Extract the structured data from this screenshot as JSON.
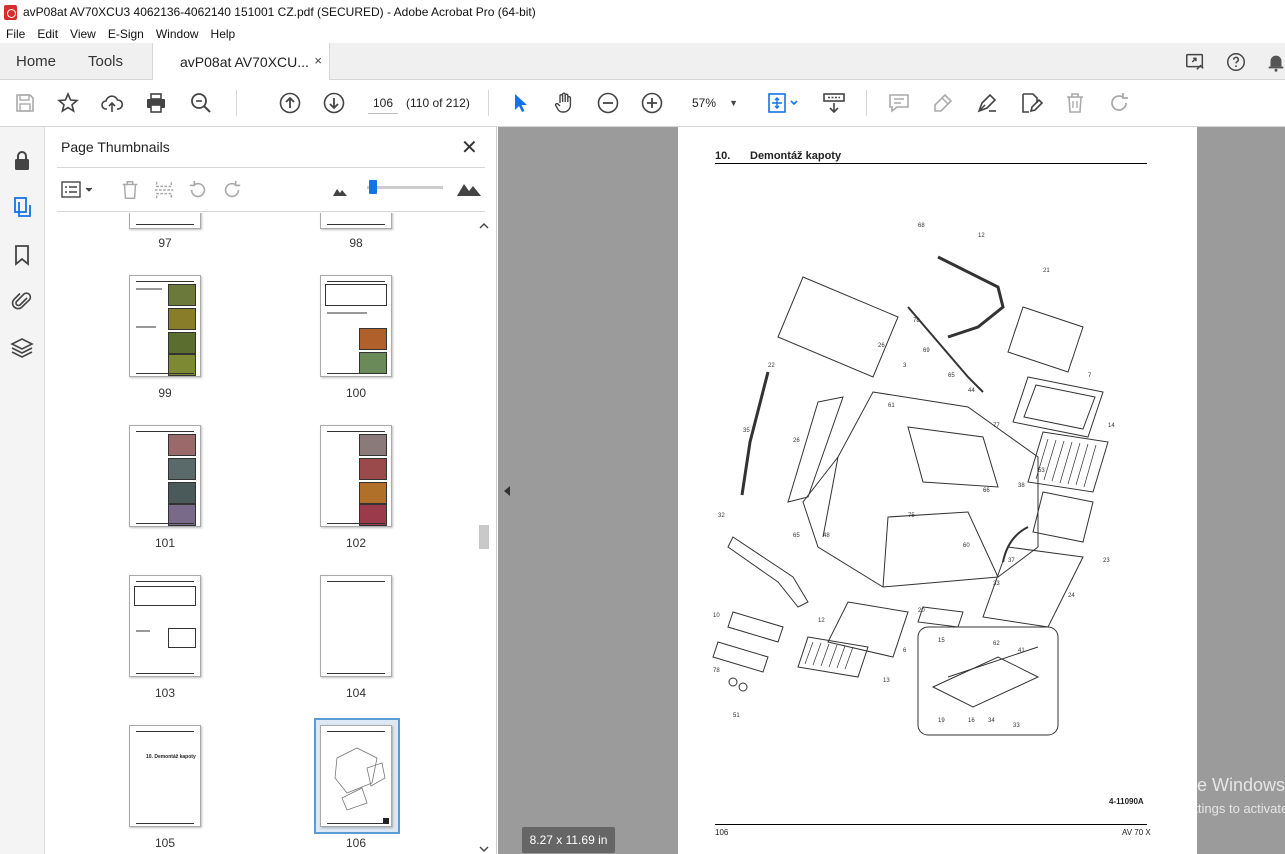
{
  "window": {
    "title": "avP08at AV70XCU3 4062136-4062140 151001 CZ.pdf (SECURED) - Adobe Acrobat Pro (64-bit)"
  },
  "menu": [
    "File",
    "Edit",
    "View",
    "E-Sign",
    "Window",
    "Help"
  ],
  "tabs": {
    "home": "Home",
    "tools": "Tools",
    "document": "avP08at AV70XCU...",
    "close": "×"
  },
  "toolbar": {
    "page_current": "106",
    "page_of": "(110 of 212)",
    "zoom": "57%",
    "zoom_caret": "▼"
  },
  "panel": {
    "title": "Page Thumbnails",
    "close": "✕",
    "thumbnails": [
      {
        "label": "97"
      },
      {
        "label": "98"
      },
      {
        "label": "99"
      },
      {
        "label": "100"
      },
      {
        "label": "101"
      },
      {
        "label": "102"
      },
      {
        "label": "103"
      },
      {
        "label": "104"
      },
      {
        "label": "105",
        "text": "10.   Demontáž kapoty"
      },
      {
        "label": "106",
        "selected": true
      }
    ]
  },
  "document": {
    "heading_num": "10.",
    "heading_text": "Demontáž kapoty",
    "figure_code": "4-11090A",
    "footer_page": "106",
    "footer_model": "AV 70 X"
  },
  "status": {
    "page_size": "8.27 x 11.69 in"
  },
  "watermark": {
    "line1": "Activate Windows",
    "line2": "Go to Settings to activate Windows."
  },
  "colors": {
    "accent": "#1473e6",
    "doc_bg": "#9b9b9b",
    "selection": "#5b9bd5"
  }
}
